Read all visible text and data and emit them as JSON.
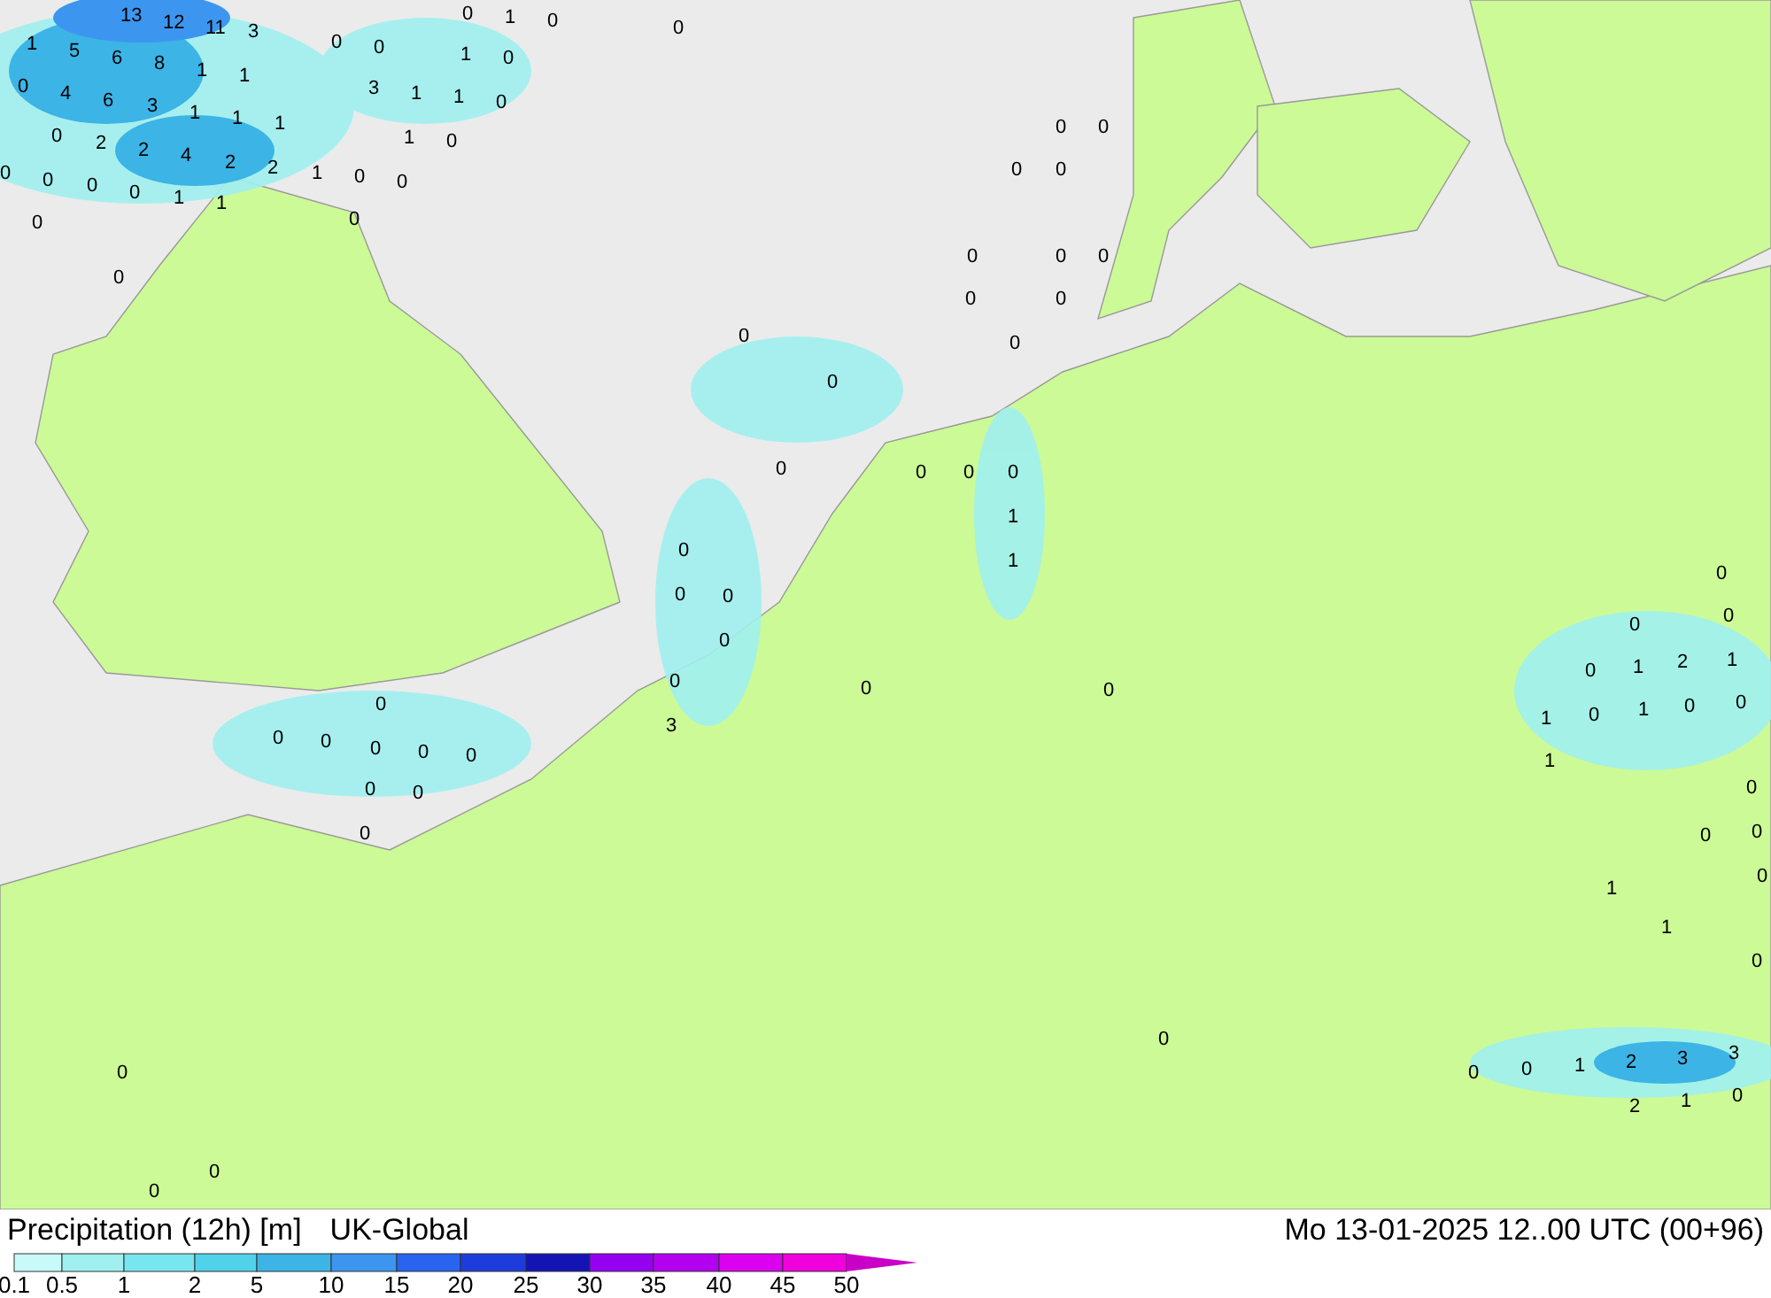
{
  "map_labels": [
    "13",
    "12",
    "11",
    "3",
    "1",
    "5",
    "6",
    "8",
    "1",
    "1",
    "0",
    "4",
    "6",
    "3",
    "1",
    "1",
    "1",
    "0",
    "2",
    "2",
    "4",
    "2",
    "2",
    "1",
    "0",
    "0",
    "0",
    "0",
    "0",
    "0",
    "1",
    "1",
    "0",
    "0",
    "0",
    "0",
    "0",
    "1",
    "0",
    "3",
    "1",
    "1",
    "0",
    "1",
    "0",
    "0",
    "1",
    "0",
    "0",
    "0",
    "0",
    "0",
    "0",
    "0",
    "0",
    "0",
    "0",
    "0",
    "0",
    "0",
    "0",
    "0",
    "0",
    "0",
    "0",
    "1",
    "1",
    "0",
    "0",
    "0",
    "0",
    "0",
    "3",
    "0",
    "0",
    "0",
    "0",
    "0",
    "0",
    "0",
    "0",
    "0",
    "0",
    "0",
    "0",
    "0",
    "0",
    "0",
    "1",
    "2",
    "1",
    "1",
    "0",
    "1",
    "0",
    "0",
    "1",
    "0",
    "0",
    "0",
    "1",
    "1",
    "0",
    "0",
    "0",
    "0",
    "0",
    "1",
    "2",
    "3",
    "3",
    "2",
    "1",
    "0",
    "0",
    "0",
    "0"
  ],
  "legend": {
    "title": "Precipitation (12h) [m]",
    "model": "UK-Global",
    "datetime": "Mo 13-01-2025 12..00 UTC (00+96)",
    "bins": [
      {
        "label": "0.1",
        "color": "#c8fafa"
      },
      {
        "label": "0.5",
        "color": "#a0f0f0"
      },
      {
        "label": "1",
        "color": "#78e6ee"
      },
      {
        "label": "2",
        "color": "#50d2ea"
      },
      {
        "label": "5",
        "color": "#3cb4e6"
      },
      {
        "label": "10",
        "color": "#3c96f0"
      },
      {
        "label": "15",
        "color": "#2864f0"
      },
      {
        "label": "20",
        "color": "#1e3cdc"
      },
      {
        "label": "25",
        "color": "#1414b4"
      },
      {
        "label": "30",
        "color": "#9600f0"
      },
      {
        "label": "35",
        "color": "#b400f0"
      },
      {
        "label": "40",
        "color": "#dc00f0"
      },
      {
        "label": "45",
        "color": "#f000dc"
      },
      {
        "label": "50",
        "color": "#c800c8"
      }
    ]
  }
}
